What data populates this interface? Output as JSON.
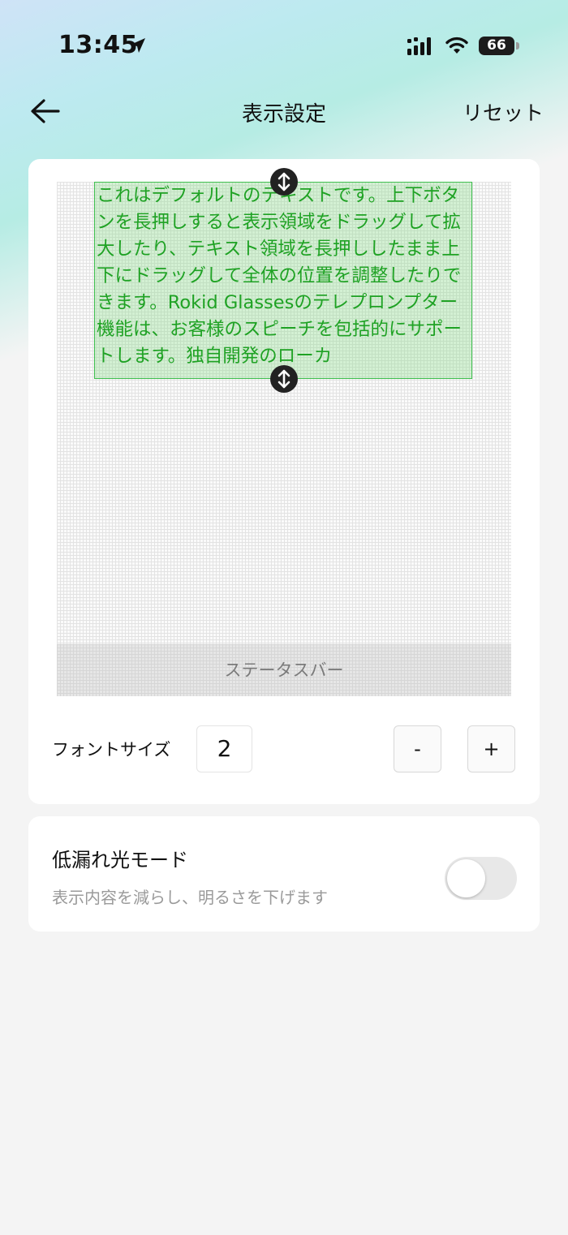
{
  "status_bar": {
    "time": "13:45",
    "battery_level": "66",
    "icons": [
      "location-arrow-icon",
      "signal-icon",
      "wifi-icon",
      "battery-icon"
    ]
  },
  "navbar": {
    "back_icon": "arrow-left-icon",
    "title": "表示設定",
    "reset_label": "リセット"
  },
  "preview": {
    "sample_text": "これはデフォルトのテキストです。上下ボタンを長押しすると表示領域をドラッグして拡大したり、テキスト領域を長押ししたまま上下にドラッグして全体の位置を調整したりできます。Rokid Glassesのテレプロンプター機能は、お客様のスピーチを包括的にサポートします。独自開発のローカ",
    "status_bar_label": "ステータスバー",
    "text_color": "#1fa224",
    "handle_icon": "vertical-resize-icon"
  },
  "font_size": {
    "label": "フォントサイズ",
    "value": "2",
    "decrease_label": "-",
    "increase_label": "+"
  },
  "low_leak_mode": {
    "title": "低漏れ光モード",
    "description": "表示内容を減らし、明るさを下げます",
    "enabled": false
  }
}
